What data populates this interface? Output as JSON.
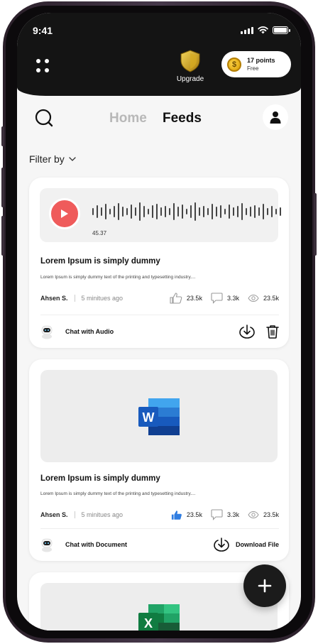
{
  "status_bar": {
    "time": "9:41"
  },
  "header": {
    "upgrade_label": "Upgrade",
    "points_title": "17 points",
    "points_subtitle": "Free"
  },
  "nav": {
    "home": "Home",
    "feeds": "Feeds"
  },
  "filter": {
    "label": "Filter by"
  },
  "colors": {
    "accent_red": "#ef5b5b",
    "like_blue": "#2f7de1",
    "dark": "#141414"
  },
  "posts": [
    {
      "type": "audio",
      "duration": "45.37",
      "title": "Lorem Ipsum is simply dummy",
      "description": "Lorem Ipsum is simply dummy text of the printing and typesetting industry....",
      "author": "Ahsen S.",
      "time_ago": "5 minitues ago",
      "likes": "23.5k",
      "comments": "3.3k",
      "views": "23.5k",
      "liked": false,
      "action_label": "Chat with Audio",
      "icons": [
        "play-icon",
        "like-icon",
        "comment-icon",
        "eye-icon",
        "robot-icon",
        "download-icon",
        "trash-icon"
      ]
    },
    {
      "type": "document",
      "file_app": "word",
      "title": "Lorem Ipsum is simply dummy",
      "description": "Lorem Ipsum is simply dummy text of the printing and typesetting industry....",
      "author": "Ahsen S.",
      "time_ago": "5 minitues ago",
      "likes": "23.5k",
      "comments": "3.3k",
      "views": "23.5k",
      "liked": true,
      "action_label": "Chat with Document",
      "download_label": "Download File",
      "icons": [
        "word-icon",
        "like-icon",
        "comment-icon",
        "eye-icon",
        "robot-icon",
        "download-icon"
      ]
    },
    {
      "type": "document",
      "file_app": "excel",
      "icons": [
        "excel-icon"
      ]
    }
  ]
}
